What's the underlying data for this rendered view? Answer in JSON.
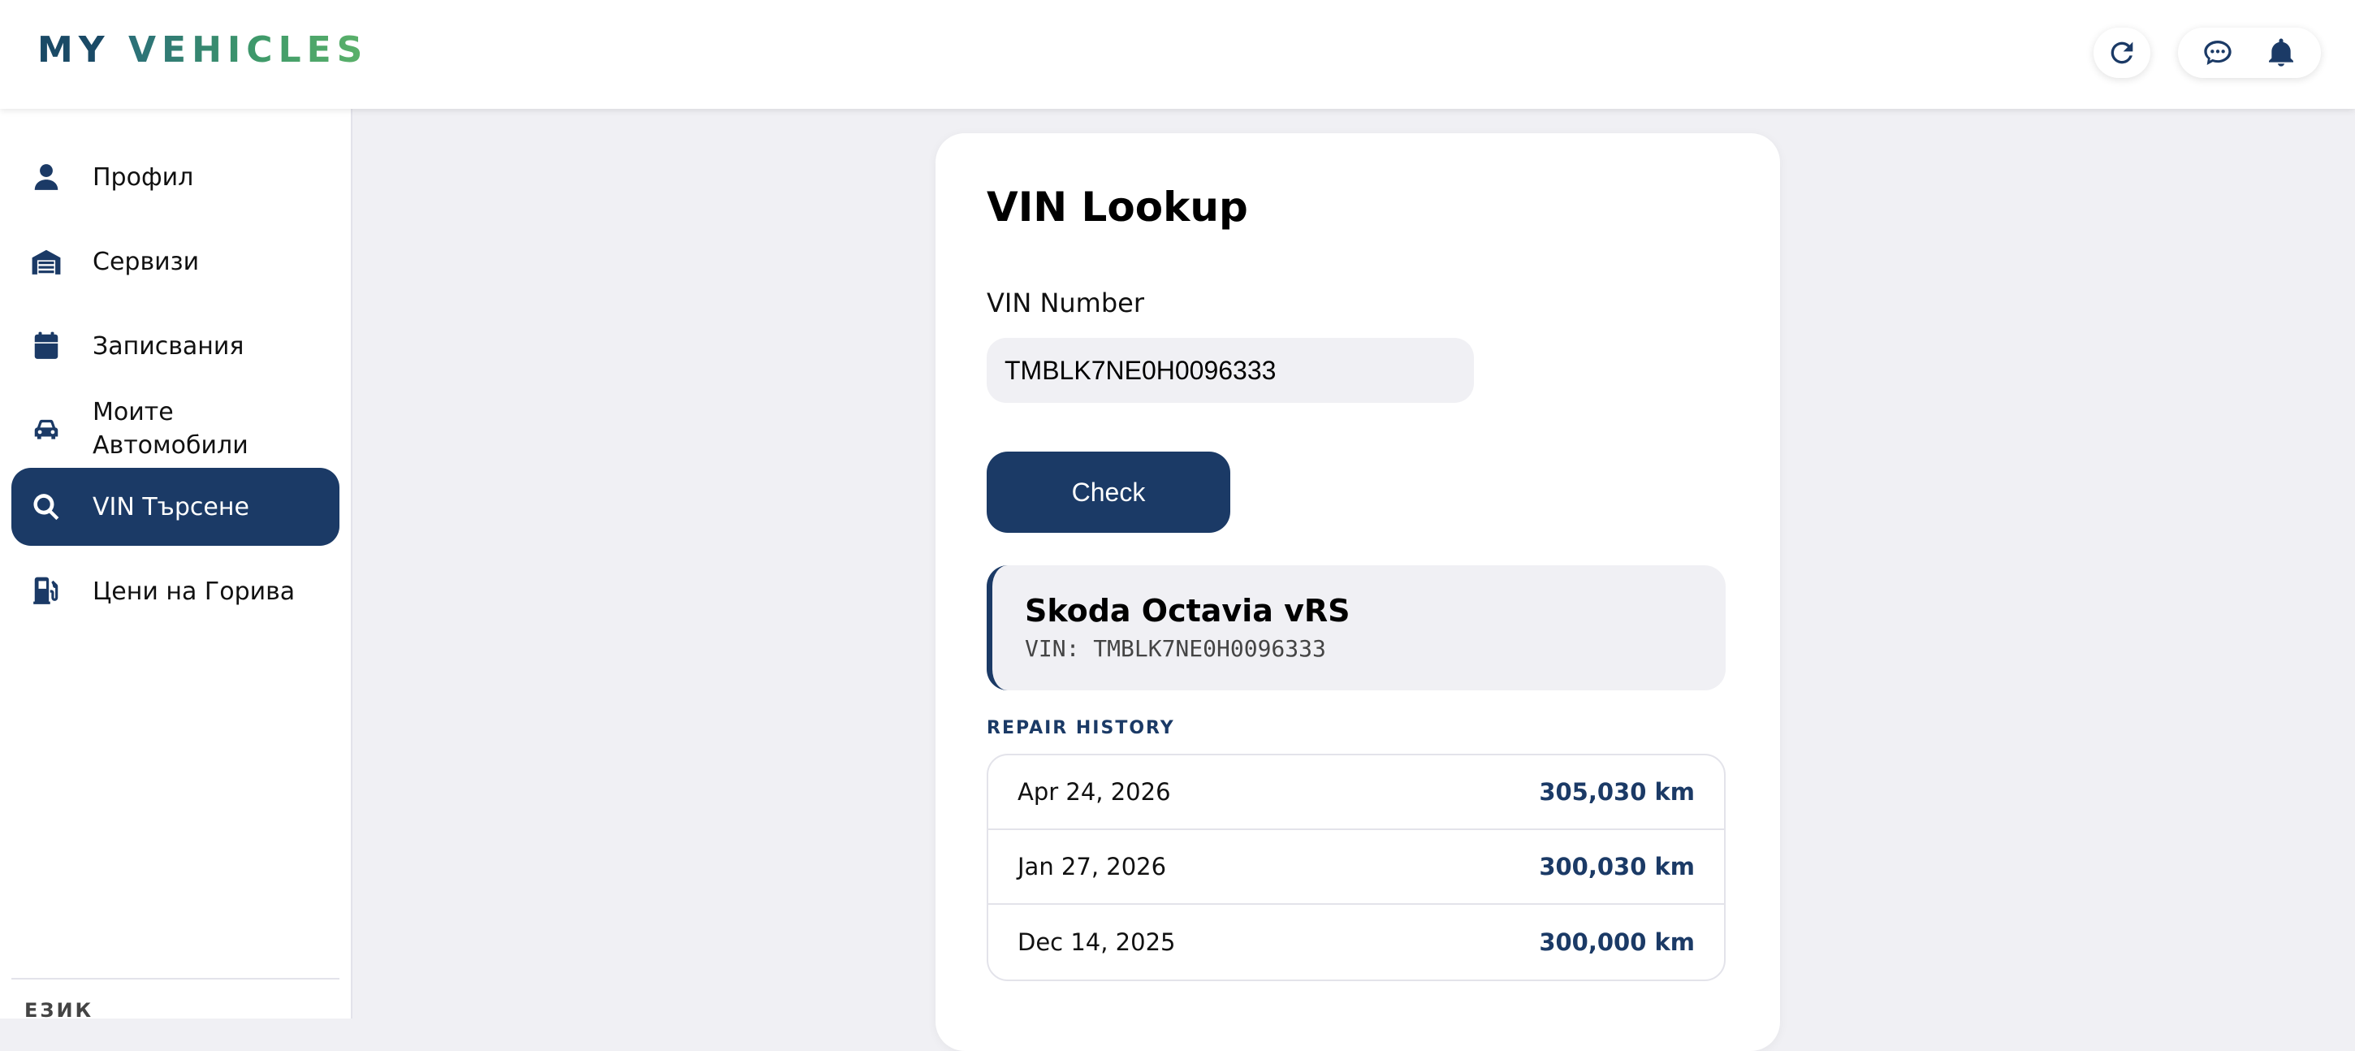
{
  "header": {
    "brand_part1": "MY",
    "brand_part2": "VEHICLES",
    "icons": [
      "refresh-icon",
      "chat-icon",
      "bell-icon"
    ]
  },
  "sidebar": {
    "items": [
      {
        "label": "Профил",
        "icon": "user-icon"
      },
      {
        "label": "Сервизи",
        "icon": "garage-icon"
      },
      {
        "label": "Записвания",
        "icon": "calendar-icon"
      },
      {
        "label": "Моите Автомобили",
        "icon": "car-icon"
      },
      {
        "label": "VIN Търсене",
        "icon": "search-icon",
        "active": true
      },
      {
        "label": "Цени на Горива",
        "icon": "fuel-pump-icon"
      }
    ],
    "language_label": "ЕЗИК"
  },
  "card": {
    "title": "VIN Lookup",
    "vin_label": "VIN Number",
    "vin_value": "TMBLK7NE0H0096333",
    "check_label": "Check",
    "vehicle": {
      "name": "Skoda Octavia vRS",
      "vin_text": "VIN: TMBLK7NE0H0096333"
    },
    "repair_history_label": "REPAIR HISTORY",
    "repairs": [
      {
        "date": "Apr 24, 2026",
        "km": "305,030 km"
      },
      {
        "date": "Jan 27, 2026",
        "km": "300,030 km"
      },
      {
        "date": "Dec 14, 2025",
        "km": "300,000 km"
      }
    ]
  },
  "colors": {
    "primary": "#1b3a66",
    "background": "#f0f0f4",
    "card": "#ffffff",
    "brand_green": "#5cb26a"
  }
}
